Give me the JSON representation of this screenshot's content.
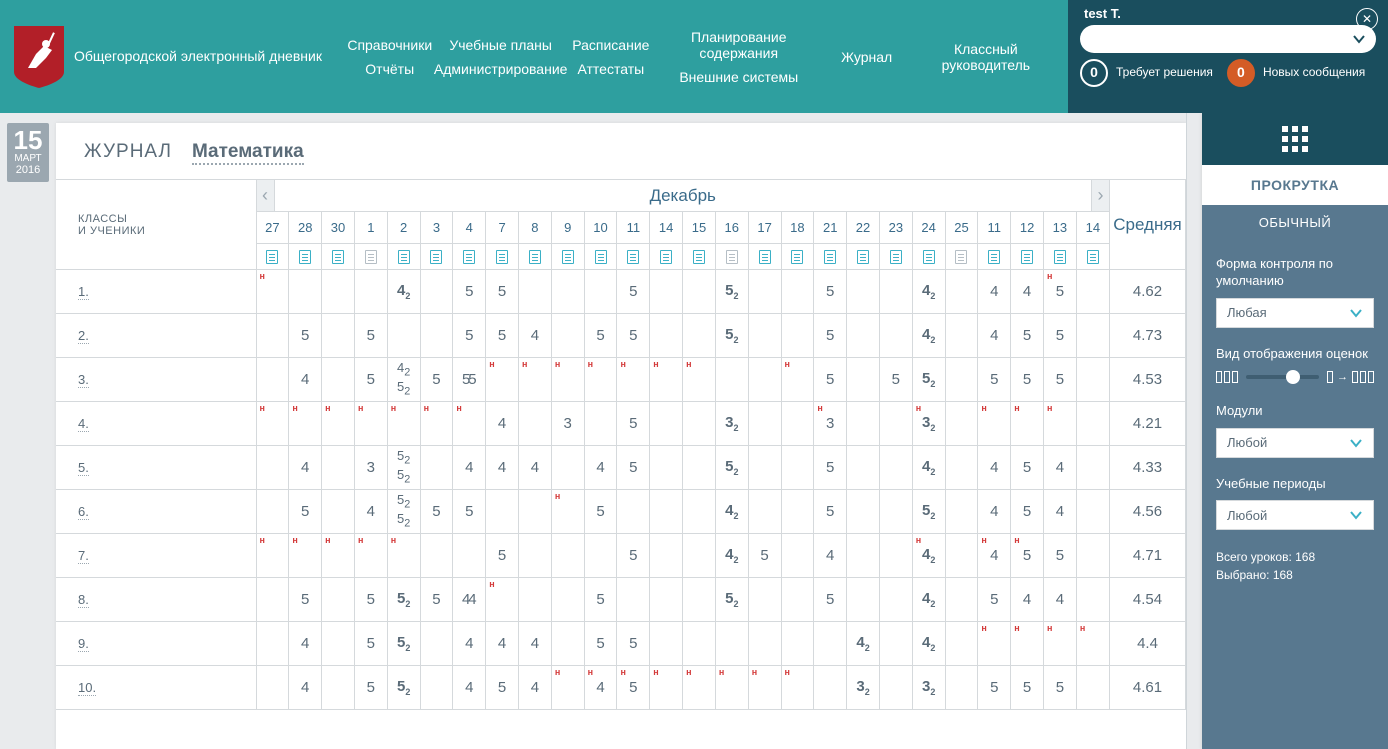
{
  "app_title": "Общегородской электронный дневник",
  "nav": {
    "col1": [
      "Справочники",
      "Отчёты"
    ],
    "col2": [
      "Учебные планы",
      "Администрирование"
    ],
    "col3": [
      "Расписание",
      "Аттестаты"
    ],
    "col4": [
      "Планирование содержания",
      "Внешние системы"
    ],
    "col5": [
      "Журнал"
    ],
    "col6": [
      "Классный руководитель"
    ]
  },
  "user": {
    "name": "test T.",
    "noti1": {
      "count": "0",
      "label": "Требует решения"
    },
    "noti2": {
      "count": "0",
      "label": "Новых сообщения"
    }
  },
  "date": {
    "day": "15",
    "month": "МАРТ",
    "year": "2016"
  },
  "page": {
    "section": "ЖУРНАЛ",
    "subject": "Математика"
  },
  "month_header": "Декабрь",
  "avg_header": "Средняя",
  "students_header": "КЛАССЫ\nИ УЧЕНИКИ",
  "days": [
    "27",
    "28",
    "30",
    "1",
    "2",
    "3",
    "4",
    "7",
    "8",
    "9",
    "10",
    "11",
    "14",
    "15",
    "16",
    "17",
    "18",
    "21",
    "22",
    "23",
    "24",
    "25",
    "11",
    "12",
    "13",
    "14"
  ],
  "day_icon_grey": [
    false,
    false,
    false,
    true,
    false,
    false,
    false,
    false,
    false,
    false,
    false,
    false,
    false,
    false,
    true,
    false,
    false,
    false,
    false,
    false,
    false,
    true,
    false,
    false,
    false,
    false
  ],
  "rows": [
    {
      "stud": "1.",
      "avg": "4.62",
      "cells": [
        "",
        "",
        "",
        "",
        "4b2",
        "",
        "5",
        "5",
        "",
        "",
        "",
        "5",
        "",
        "",
        "5b2",
        "",
        "",
        "5",
        "",
        "",
        "4b2",
        "",
        "4",
        "4",
        "5",
        ""
      ],
      "n": [
        0,
        24
      ]
    },
    {
      "stud": "2.",
      "avg": "4.73",
      "cells": [
        "",
        "5",
        "",
        "5",
        "",
        "",
        "5",
        "5",
        "4",
        "",
        "5",
        "5",
        "",
        "",
        "5b2",
        "",
        "",
        "5",
        "",
        "",
        "4b2",
        "",
        "4",
        "5",
        "5",
        ""
      ]
    },
    {
      "stud": "3.",
      "avg": "4.53",
      "cells": [
        "",
        "4",
        "",
        "5",
        "stack:4b2|5b2",
        "5",
        "5r|5",
        "",
        "",
        "",
        "",
        "",
        "",
        "",
        "",
        "",
        "",
        "5",
        "",
        "5",
        "5b2",
        "",
        "5",
        "5",
        "5",
        ""
      ],
      "n": [
        7,
        8,
        9,
        10,
        11,
        12,
        13,
        16
      ]
    },
    {
      "stud": "4.",
      "avg": "4.21",
      "cells": [
        "",
        "",
        "",
        "",
        "",
        "",
        "",
        "4",
        "",
        "3",
        "",
        "5",
        "",
        "",
        "3b2",
        "",
        "",
        "3",
        "",
        "",
        "3b2",
        "",
        "",
        "",
        "",
        ""
      ],
      "n": [
        0,
        1,
        2,
        3,
        4,
        5,
        6,
        17,
        20,
        22,
        23,
        24
      ]
    },
    {
      "stud": "5.",
      "avg": "4.33",
      "cells": [
        "",
        "4",
        "",
        "3",
        "stack:5b2|5b2",
        "",
        "4",
        "4",
        "4",
        "",
        "4",
        "5",
        "",
        "",
        "5b2",
        "",
        "",
        "5",
        "",
        "",
        "4b2",
        "",
        "4",
        "5",
        "4",
        ""
      ]
    },
    {
      "stud": "6.",
      "avg": "4.56",
      "cells": [
        "",
        "5",
        "",
        "4",
        "stack:5b2|5b2",
        "5",
        "5",
        "",
        "",
        "",
        "5",
        "",
        "",
        "",
        "4b2",
        "",
        "",
        "5",
        "",
        "",
        "5b2",
        "",
        "4",
        "5",
        "4",
        ""
      ],
      "n": [
        9
      ]
    },
    {
      "stud": "7.",
      "avg": "4.71",
      "cells": [
        "",
        "",
        "",
        "",
        "",
        "",
        "",
        "5",
        "",
        "",
        "",
        "5",
        "",
        "",
        "4b2",
        "5",
        "",
        "4",
        "",
        "",
        "4b2",
        "",
        "4",
        "5",
        "5",
        ""
      ],
      "n": [
        0,
        1,
        2,
        3,
        4,
        20,
        22,
        23
      ]
    },
    {
      "stud": "8.",
      "avg": "4.54",
      "cells": [
        "",
        "5",
        "",
        "5",
        "5b2",
        "5",
        "4r|4",
        "",
        "",
        "",
        "5",
        "",
        "",
        "",
        "5b2",
        "",
        "",
        "5",
        "",
        "",
        "4b2",
        "",
        "5",
        "4",
        "4",
        ""
      ],
      "n": [
        7
      ]
    },
    {
      "stud": "9.",
      "avg": "4.4",
      "cells": [
        "",
        "4",
        "",
        "5",
        "5b2",
        "",
        "4",
        "4",
        "4",
        "",
        "5",
        "5",
        "",
        "",
        "",
        "",
        "",
        "",
        "4b2",
        "",
        "4b2",
        "",
        "",
        "",
        "",
        ""
      ],
      "n": [
        22,
        23,
        24,
        25
      ]
    },
    {
      "stud": "10.",
      "avg": "4.61",
      "cells": [
        "",
        "4",
        "",
        "5",
        "5b2",
        "",
        "4",
        "5",
        "4",
        "",
        "4",
        "5",
        "",
        "",
        "",
        "",
        "",
        "",
        "3b2",
        "",
        "3b2",
        "",
        "5",
        "5",
        "5",
        ""
      ],
      "n": [
        9,
        10,
        11,
        12,
        13,
        14,
        15,
        16
      ]
    }
  ],
  "sidebar": {
    "scroll_title": "ПРОКРУТКА",
    "seg": "ОБЫЧНЫЙ",
    "form_label": "Форма контроля по умолчанию",
    "form_value": "Любая",
    "view_label": "Вид отображения оценок",
    "modules_label": "Модули",
    "modules_value": "Любой",
    "periods_label": "Учебные периоды",
    "periods_value": "Любой",
    "total_lessons": "Всего уроков: 168",
    "selected": "Выбрано: 168"
  }
}
